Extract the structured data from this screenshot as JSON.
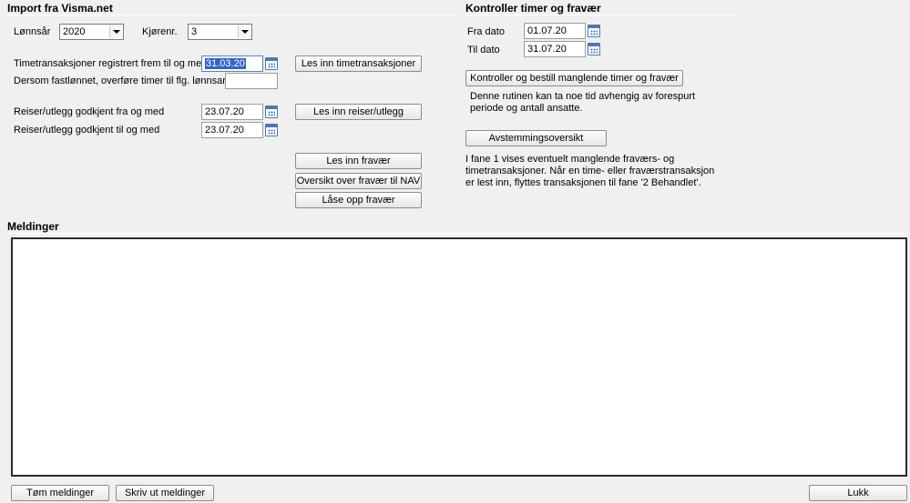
{
  "import_section": {
    "title": "Import fra Visma.net",
    "lonnsar_label": "Lønnsår",
    "lonnsar_value": "2020",
    "kjorenr_label": "Kjørenr.",
    "kjorenr_value": "3",
    "timetrans_label": "Timetransaksjoner registrert frem til og med",
    "timetrans_date": "31.03.20",
    "fastlonnet_label": "Dersom fastlønnet, overføre timer til flg. lønnsart",
    "fastlonnet_value": "",
    "reiser_fra_label": "Reiser/utlegg godkjent fra og med",
    "reiser_fra_date": "23.07.20",
    "reiser_til_label": "Reiser/utlegg godkjent til og med",
    "reiser_til_date": "23.07.20",
    "btn_timetrans": "Les inn timetransaksjoner",
    "btn_reiser": "Les inn reiser/utlegg",
    "btn_fravaer": "Les inn fravær",
    "btn_oversikt_nav": "Oversikt over fravær til NAV",
    "btn_laase_opp": "Låse opp fravær"
  },
  "control_section": {
    "title": "Kontroller timer og fravær",
    "fra_dato_label": "Fra dato",
    "fra_dato_value": "01.07.20",
    "til_dato_label": "Til dato",
    "til_dato_value": "31.07.20",
    "btn_kontroller": "Kontroller og bestill manglende timer og fravær",
    "desc1_line1": "Denne rutinen kan ta noe tid avhengig av forespurt",
    "desc1_line2": "periode og antall ansatte.",
    "btn_avstemming": "Avstemmingsoversikt",
    "desc2_line1": "I fane 1 vises eventuelt manglende fraværs- og",
    "desc2_line2": "timetransaksjoner. Når en time- eller fraværstransaksjon",
    "desc2_line3": "er lest inn, flyttes transaksjonen til fane '2 Behandlet'."
  },
  "messages": {
    "title": "Meldinger",
    "content": ""
  },
  "footer": {
    "btn_tom": "Tøm meldinger",
    "btn_skriv": "Skriv ut meldinger",
    "btn_lukk": "Lukk"
  },
  "icons": {
    "calendar": "calendar-icon",
    "dropdown": "chevron-down-icon"
  },
  "colors": {
    "selection": "#3264c8",
    "calendar_accent": "#4a78b8"
  }
}
